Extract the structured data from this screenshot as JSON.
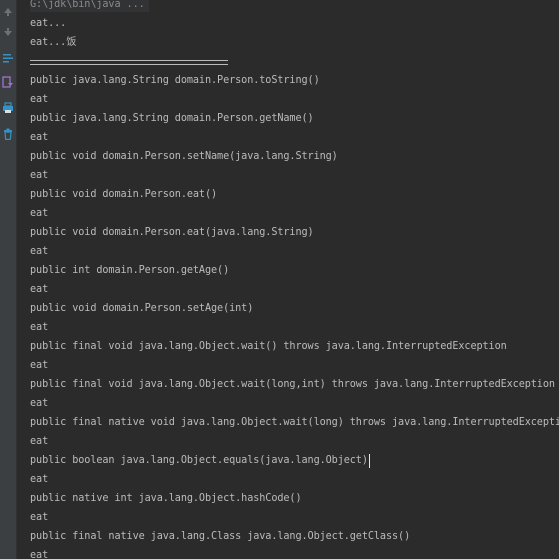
{
  "gutter": {
    "icons": [
      "arrow-up-icon",
      "arrow-down-icon",
      "soft-wrap-icon",
      "scroll-to-end-icon",
      "print-icon",
      "clear-all-icon"
    ]
  },
  "console": {
    "command": "G:\\jdk\\bin\\java ...",
    "output": [
      "eat...",
      "eat...饭",
      "public java.lang.String domain.Person.toString()",
      "eat",
      "public java.lang.String domain.Person.getName()",
      "eat",
      "public void domain.Person.setName(java.lang.String)",
      "eat",
      "public void domain.Person.eat()",
      "eat",
      "public void domain.Person.eat(java.lang.String)",
      "eat",
      "public int domain.Person.getAge()",
      "eat",
      "public void domain.Person.setAge(int)",
      "eat",
      "public final void java.lang.Object.wait() throws java.lang.InterruptedException",
      "eat",
      "public final void java.lang.Object.wait(long,int) throws java.lang.InterruptedException",
      "eat",
      "public final native void java.lang.Object.wait(long) throws java.lang.InterruptedException",
      "eat",
      "public boolean java.lang.Object.equals(java.lang.Object)",
      "eat",
      "public native int java.lang.Object.hashCode()",
      "eat",
      "public final native java.lang.Class java.lang.Object.getClass()",
      "eat"
    ]
  },
  "colors": {
    "background": "#2b2b2b",
    "gutter": "#3c3f41",
    "text": "#bbbbbb",
    "command_text": "#8a8a8a"
  }
}
